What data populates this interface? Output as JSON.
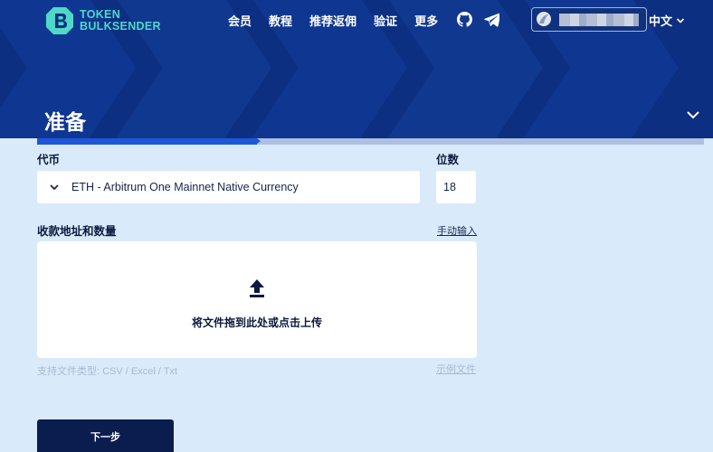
{
  "brand": {
    "line1": "TOKEN",
    "line2": "BULKSENDER"
  },
  "nav": {
    "items": [
      "会员",
      "教程",
      "推荐返佣",
      "验证",
      "更多"
    ]
  },
  "header": {
    "language": "中文",
    "page_title": "准备"
  },
  "progress": {
    "completed_fraction": 0.33
  },
  "form": {
    "token_label": "代币",
    "token_value": "ETH - Arbitrum One Mainnet Native Currency",
    "decimals_label": "位数",
    "decimals_value": "18",
    "recipients_label": "收款地址和数量",
    "manual_input_link": "手动输入",
    "dropzone_text": "将文件拖到此处或点击上传",
    "supported_types": "支持文件类型:  CSV / Excel / Txt",
    "sample_file_link": "示例文件",
    "next_button": "下一步"
  },
  "colors": {
    "header_bg": "#0d2f82",
    "accent": "#4fd8c8",
    "page_bg": "#d9ebfb",
    "progress_fill": "#1e57d8",
    "button_bg": "#0b1d4f"
  },
  "icons": [
    "logo-icon",
    "github-icon",
    "telegram-icon",
    "wallet-avatar-icon",
    "chevron-down-icon",
    "upload-icon"
  ]
}
